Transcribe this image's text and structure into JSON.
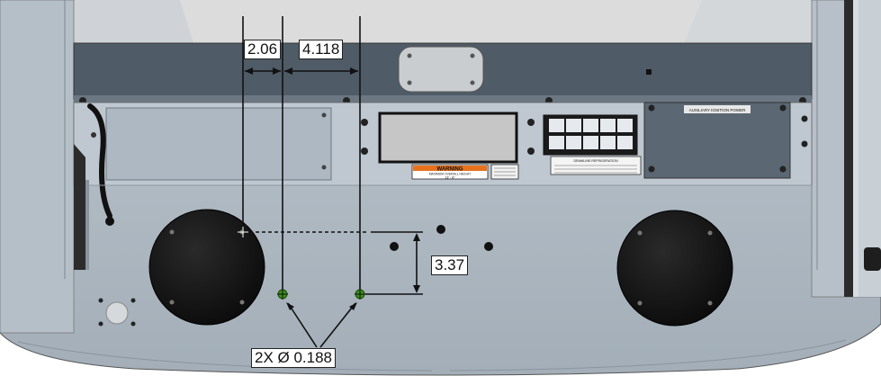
{
  "dimensions": {
    "offset_a": "2.06",
    "offset_b": "4.118",
    "vertical": "3.37",
    "hole_callout": "2X Ø 0.188"
  },
  "labels": {
    "warning_title": "WARNING",
    "warning_line1": "MAXIMUM OVERALL HEIGHT",
    "warning_line2": "13' - 6\"",
    "aux_panel_title": "AUXILIARY IGNITION POWER",
    "control_chart_title": "DRAWLINE REFRIGERATION"
  },
  "colors": {
    "body_gray": "#aeb8c2",
    "body_gray_light": "#c3ccd4",
    "rail_dark": "#4f5b66",
    "panel_dark": "#5b6773",
    "wheel_black": "#151515",
    "hole_green": "#3c8f1a",
    "warning_orange": "#e8721c"
  }
}
